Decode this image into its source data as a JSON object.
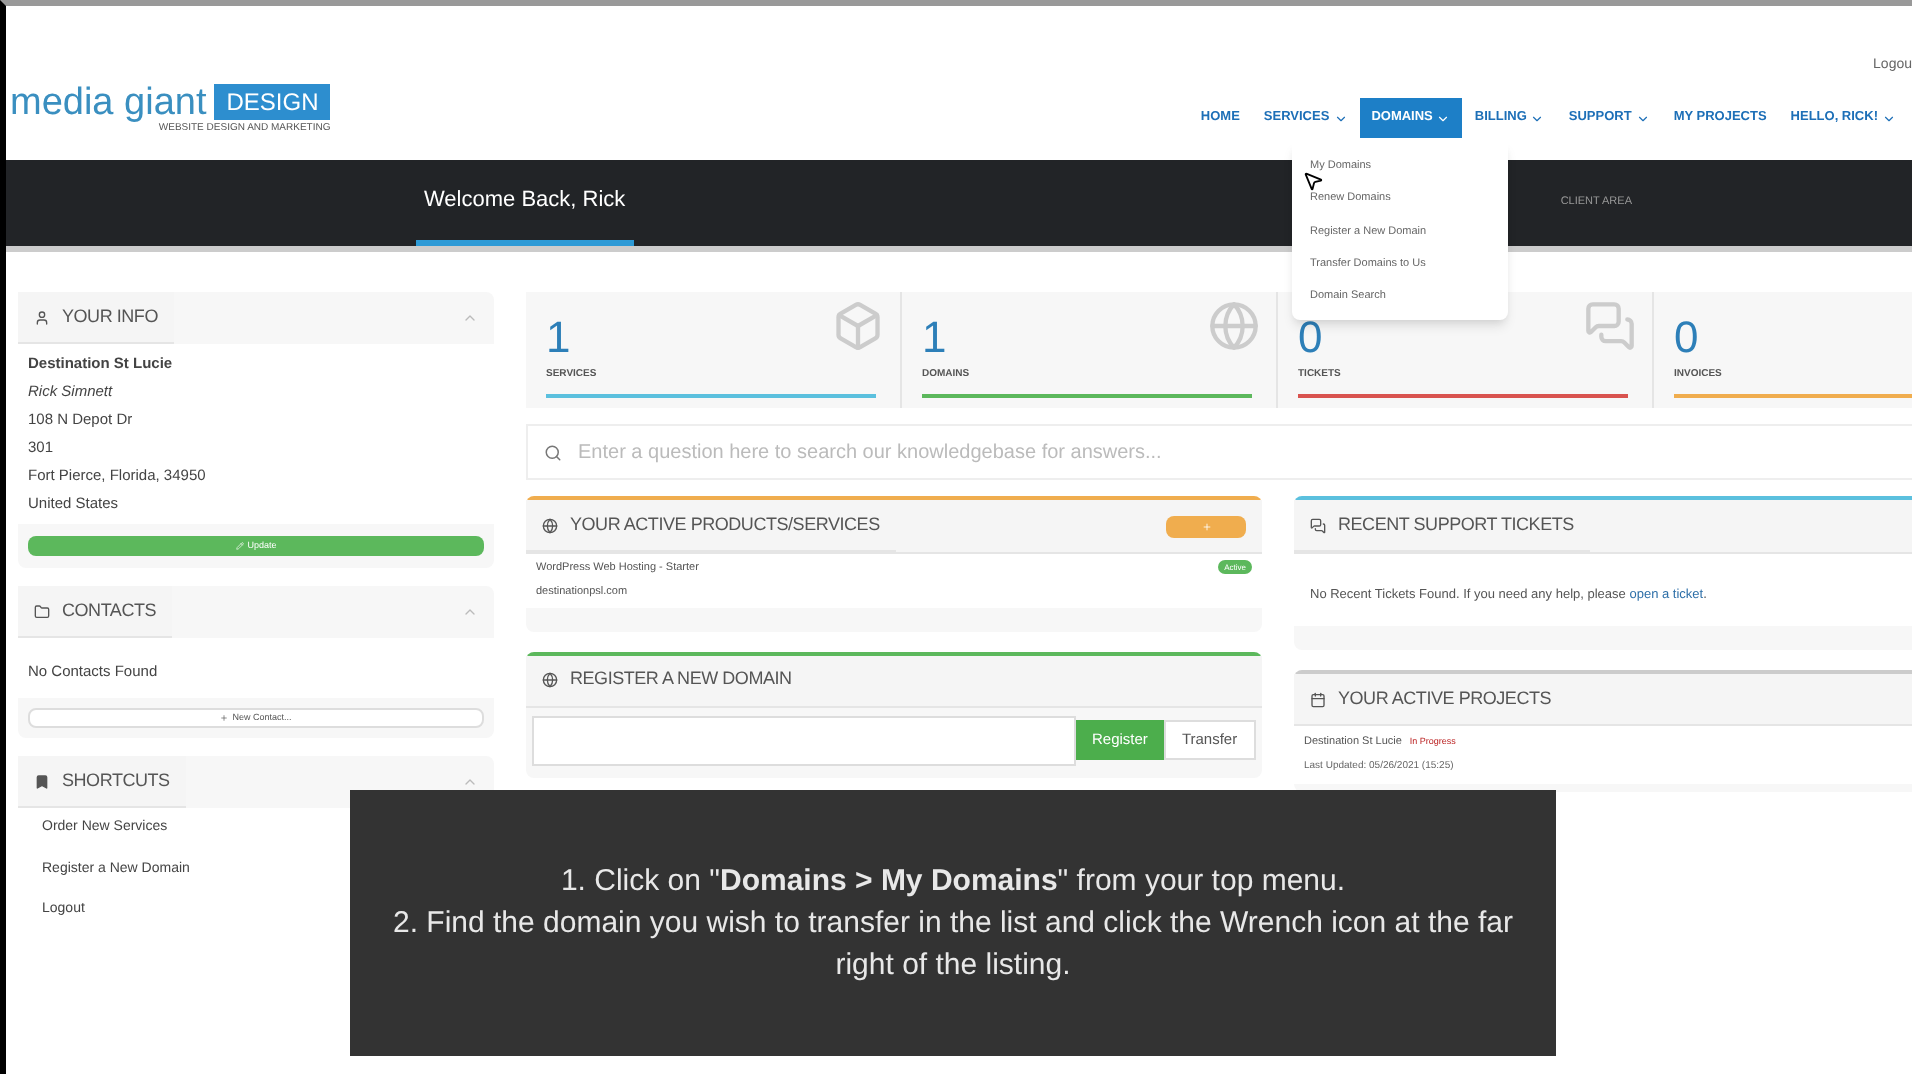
{
  "header": {
    "logo": {
      "name": "media giant",
      "badge": "DESIGN",
      "tagline": "WEBSITE DESIGN AND MARKETING"
    },
    "top_link": "Logou",
    "nav": [
      {
        "label": "HOME",
        "dropdown": false,
        "selected": false
      },
      {
        "label": "SERVICES",
        "dropdown": true,
        "selected": false
      },
      {
        "label": "DOMAINS",
        "dropdown": true,
        "selected": true
      },
      {
        "label": "BILLING",
        "dropdown": true,
        "selected": false
      },
      {
        "label": "SUPPORT",
        "dropdown": true,
        "selected": false
      },
      {
        "label": "MY PROJECTS",
        "dropdown": false,
        "selected": false
      },
      {
        "label": "HELLO, RICK!",
        "dropdown": true,
        "selected": false
      }
    ],
    "dropdown_menu": [
      "My Domains",
      "Renew Domains",
      "Register a New Domain",
      "Transfer Domains to Us",
      "Domain Search"
    ]
  },
  "banner": {
    "title": "Welcome Back, Rick",
    "breadcrumb": "CLIENT AREA"
  },
  "your_info": {
    "title": "YOUR INFO",
    "company": "Destination St Lucie",
    "name": "Rick Simnett",
    "lines": [
      "108 N Depot Dr",
      "301",
      "Fort Pierce, Florida, 34950",
      "United States"
    ],
    "button": "Update"
  },
  "contacts": {
    "title": "CONTACTS",
    "empty": "No Contacts Found",
    "button": "New Contact..."
  },
  "shortcuts": {
    "title": "SHORTCUTS",
    "items": [
      "Order New Services",
      "Register a New Domain",
      "Logout"
    ]
  },
  "stats": [
    {
      "value": "1",
      "label": "SERVICES",
      "kind": "box",
      "color": "#5bc0de"
    },
    {
      "value": "1",
      "label": "DOMAINS",
      "kind": "globe",
      "color": "#5cb85c"
    },
    {
      "value": "0",
      "label": "TICKETS",
      "kind": "chat",
      "color": "#d9534f"
    },
    {
      "value": "0",
      "label": "INVOICES",
      "kind": "none",
      "color": "#f0ad4e"
    }
  ],
  "search": {
    "placeholder": "Enter a question here to search our knowledgebase for answers..."
  },
  "products": {
    "title": "YOUR ACTIVE PRODUCTS/SERVICES",
    "items": [
      {
        "product": "WordPress Web Hosting - Starter",
        "domain": "destinationpsl.com",
        "status": "Active"
      }
    ]
  },
  "register_domain": {
    "title": "REGISTER A NEW DOMAIN",
    "buttons": [
      "Register",
      "Transfer"
    ]
  },
  "tickets": {
    "title": "RECENT SUPPORT TICKETS",
    "text": "No Recent Tickets Found. If you need any help, please",
    "link": "open a ticket",
    "end": "."
  },
  "projects": {
    "title": "YOUR ACTIVE PROJECTS",
    "items": [
      {
        "name": "Destination St Lucie",
        "status": "In Progress",
        "updated": "Last Updated: 05/26/2021 (15:25)"
      }
    ]
  },
  "caption": [
    "1. Click on \"**Domains > My Domains**\" from your top menu.",
    "2. Find the domain you wish to transfer in the list and click the Wrench icon at the far right of the listing."
  ]
}
